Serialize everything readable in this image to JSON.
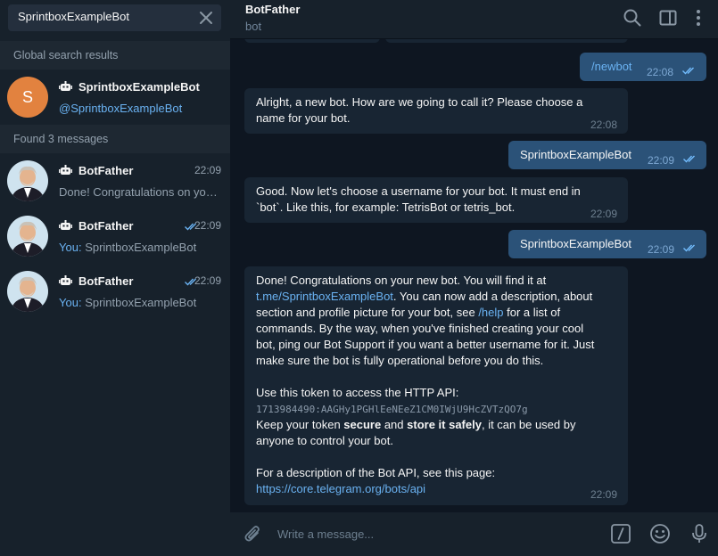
{
  "sidebar": {
    "search_value": "SprintboxExampleBot",
    "global_section": "Global search results",
    "found_section": "Found 3 messages",
    "global_result": {
      "avatar_letter": "S",
      "avatar_color": "#e2823f",
      "title": "SprintboxExampleBot",
      "subtitle": "@SprintboxExampleBot"
    },
    "message_results": [
      {
        "title": "BotFather",
        "time": "22:09",
        "prefix": "",
        "text": "Done! Congratulations on your new bot. You will find it at",
        "read": false
      },
      {
        "title": "BotFather",
        "time": "22:09",
        "prefix": "You:",
        "text": "SprintboxExampleBot",
        "read": true
      },
      {
        "title": "BotFather",
        "time": "22:09",
        "prefix": "You:",
        "text": "SprintboxExampleBot",
        "read": true
      }
    ]
  },
  "header": {
    "title": "BotFather",
    "status": "bot",
    "icons": [
      "search-icon",
      "sidebar-toggle-icon",
      "more-vertical-icon"
    ]
  },
  "messages": [
    {
      "dir": "out",
      "text": "/newbot",
      "time": "22:08"
    },
    {
      "dir": "in",
      "line1": "Alright, a new bot. How are we going to call it? Please choose a",
      "line2": "name for your bot.",
      "time": "22:08"
    },
    {
      "dir": "out",
      "text": "SprintboxExampleBot",
      "time": "22:09"
    },
    {
      "dir": "in",
      "line1": "Good. Now let's choose a username for your bot. It must end in",
      "line2": "`bot`. Like this, for example: TetrisBot or tetris_bot.",
      "time": "22:09"
    },
    {
      "dir": "out",
      "text": "SprintboxExampleBot",
      "time": "22:09"
    },
    {
      "dir": "in",
      "time": "22:09",
      "l1": "Done! Congratulations on your new bot. You will find it at",
      "link1": "t.me/SprintboxExampleBot",
      "l2": ". You can now add a description, about",
      "l3a": "section and profile picture for your bot, see ",
      "link2": "/help",
      "l3b": " for a list of",
      "l4": "commands. By the way, when you've finished creating your cool",
      "l5": "bot, ping our Bot Support if you want a better username for it. Just",
      "l6": "make sure the bot is fully operational before you do this.",
      "l7": "Use this token to access the HTTP API:",
      "token": "1713984490:AAGHy1PGHlEeNEeZ1CM0IWjU9HcZVTzQO7g",
      "l8a": "Keep your token ",
      "b1": "secure",
      "l8b": " and ",
      "b2": "store it safely",
      "l8c": ", it can be used by",
      "l9": "anyone to control your bot.",
      "l10": "For a description of the Bot API, see this page:",
      "link3": "https://core.telegram.org/bots/api"
    }
  ],
  "composer": {
    "placeholder": "Write a message...",
    "icons": [
      "attach-icon",
      "bot-command-icon",
      "emoji-icon",
      "microphone-icon"
    ]
  },
  "colors": {
    "sidebar_bg": "#17212b",
    "chat_bg": "#0e1621",
    "bubble_in": "#182533",
    "bubble_out": "#2b5278",
    "accent": "#6ab2f2"
  }
}
